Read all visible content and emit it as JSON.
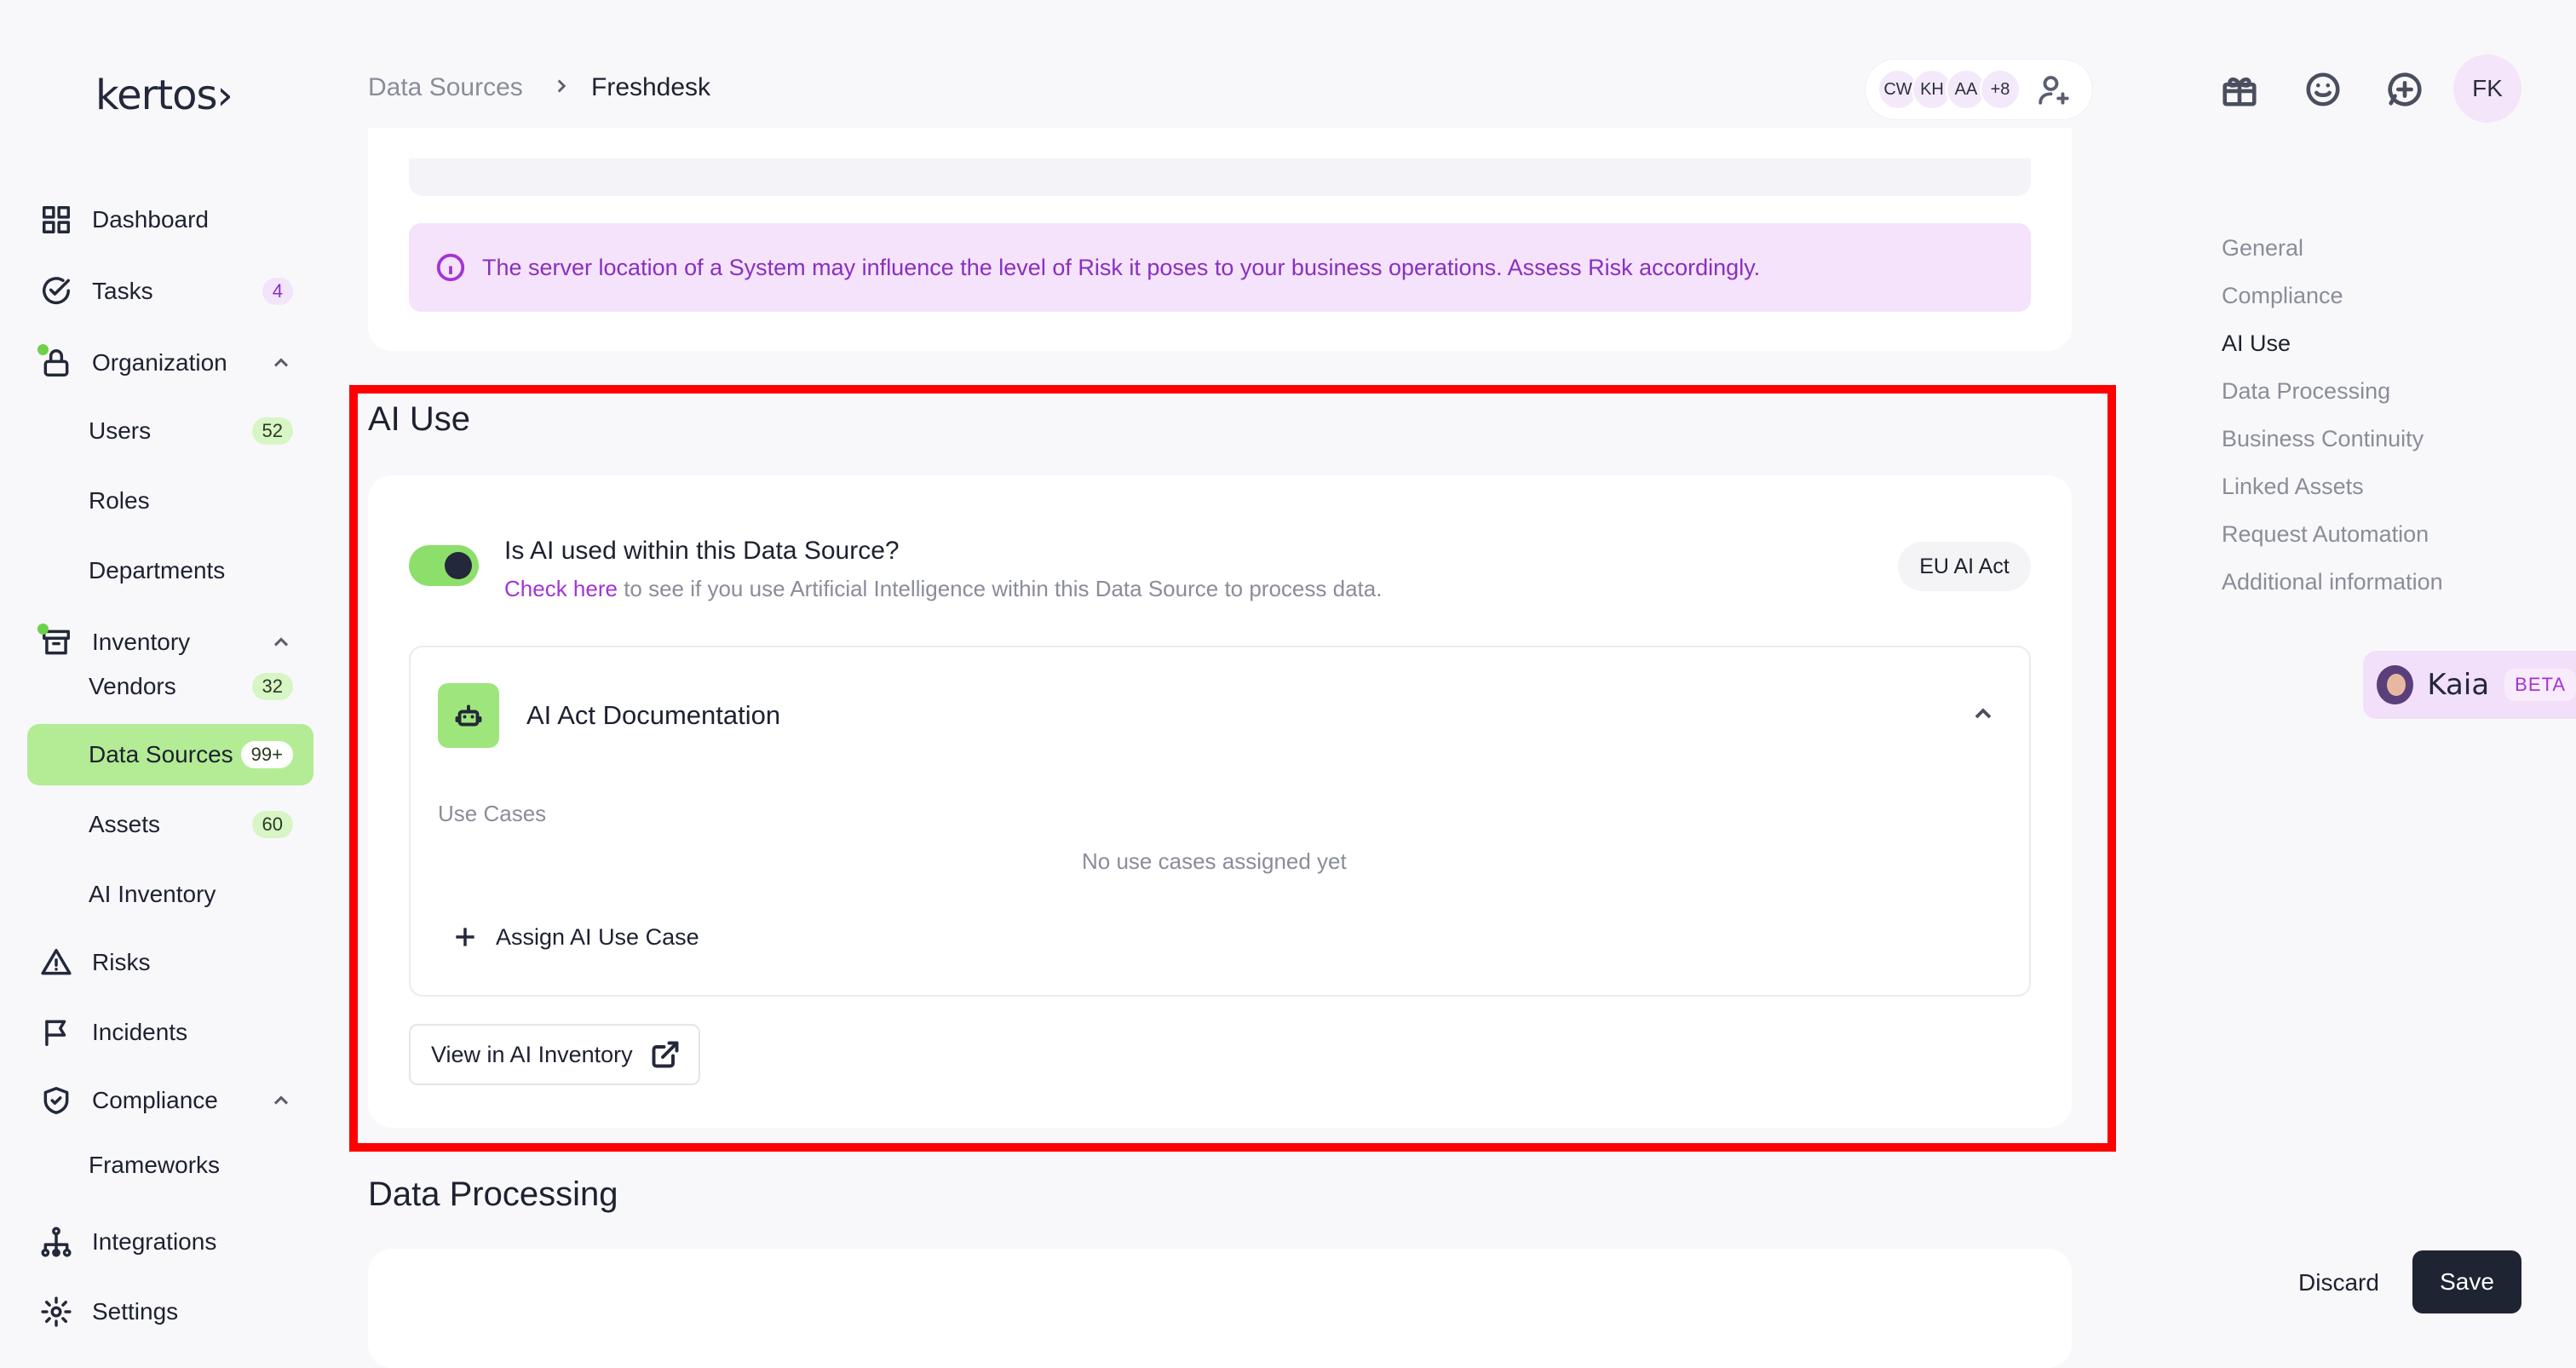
{
  "app": {
    "logo_text": "kertos›"
  },
  "sidebar": {
    "items": [
      {
        "label": "Dashboard",
        "icon": "grid-icon"
      },
      {
        "label": "Tasks",
        "icon": "check-circle-icon",
        "badge": "4"
      },
      {
        "label": "Organization",
        "icon": "lock-icon"
      },
      {
        "label": "Users",
        "badge": "52"
      },
      {
        "label": "Roles"
      },
      {
        "label": "Departments"
      },
      {
        "label": "Inventory",
        "icon": "archive-icon"
      },
      {
        "label": "Vendors",
        "badge": "32"
      },
      {
        "label": "Data Sources",
        "badge": "99+"
      },
      {
        "label": "Assets",
        "badge": "60"
      },
      {
        "label": "AI Inventory"
      },
      {
        "label": "Risks",
        "icon": "warning-icon"
      },
      {
        "label": "Incidents",
        "icon": "flag-icon"
      },
      {
        "label": "Compliance",
        "icon": "shield-check-icon"
      },
      {
        "label": "Frameworks"
      },
      {
        "label": "Integrations",
        "icon": "network-icon"
      },
      {
        "label": "Settings",
        "icon": "gear-icon"
      }
    ]
  },
  "header": {
    "breadcrumb": [
      "Data Sources",
      "Freshdesk"
    ],
    "collaborators": [
      "CW",
      "KH",
      "AA",
      "+8"
    ],
    "user_initials": "FK"
  },
  "location_section": {
    "info_text": "The server location of a System may influence the level of Risk it poses to your business operations. Assess Risk accordingly."
  },
  "ai_use": {
    "title": "AI Use",
    "question": "Is AI used within this Data Source?",
    "toggle_on": true,
    "check_link": "Check here",
    "check_rest": " to see if you use Artificial Intelligence within this Data Source to process data.",
    "chip": "EU AI Act",
    "doc_title": "AI Act Documentation",
    "use_cases_label": "Use Cases",
    "use_cases_empty": "No use cases assigned yet",
    "assign_label": "Assign AI Use Case",
    "view_label": "View in AI Inventory"
  },
  "data_processing": {
    "title": "Data Processing"
  },
  "toc": [
    "General",
    "Compliance",
    "AI Use",
    "Data Processing",
    "Business Continuity",
    "Linked Assets",
    "Request Automation",
    "Additional information"
  ],
  "assistant": {
    "name": "Kaia",
    "badge": "BETA"
  },
  "footer": {
    "discard": "Discard",
    "save": "Save"
  },
  "colors": {
    "accent_green": "#b3ec94",
    "accent_purple": "#a334d6",
    "highlight": "#ff0000",
    "primary_dark": "#1f2433"
  }
}
